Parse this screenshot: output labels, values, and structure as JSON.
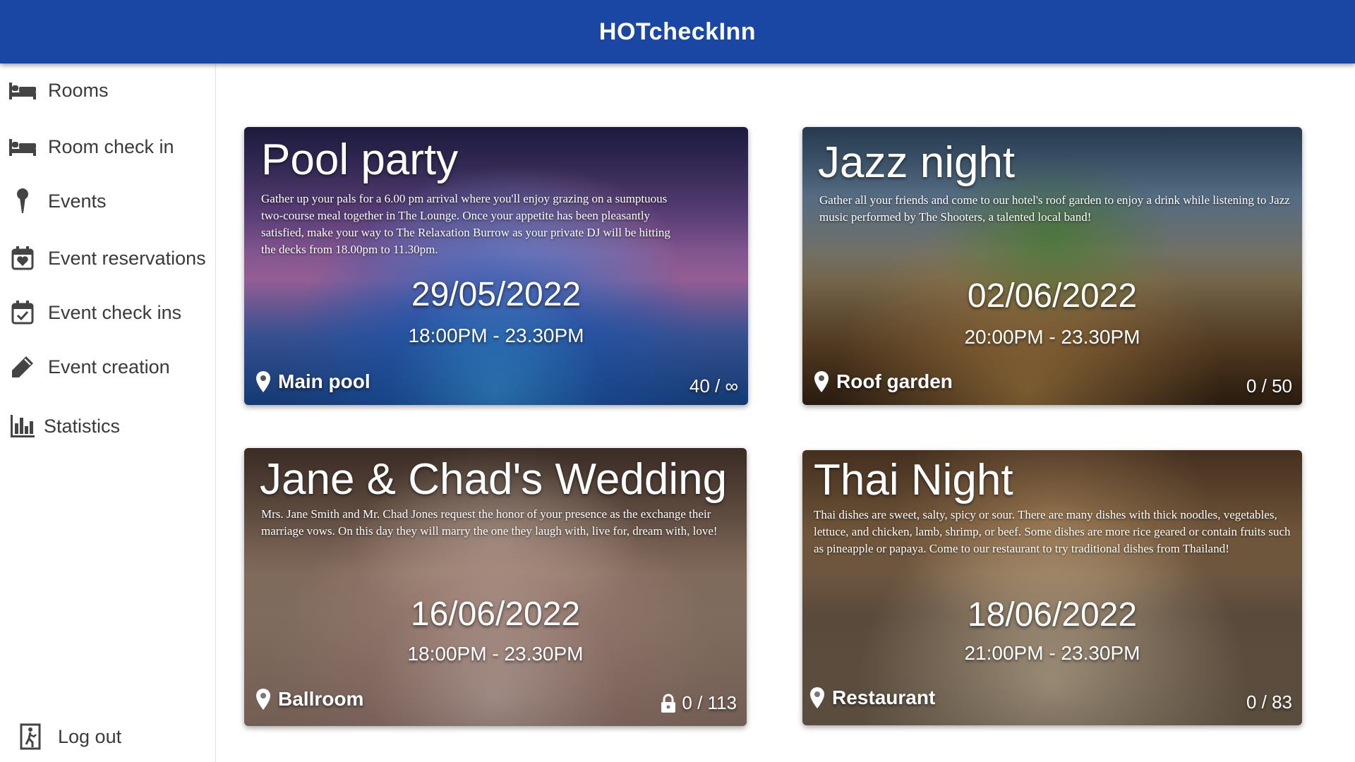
{
  "app": {
    "title": "HOTcheckInn"
  },
  "sidebar": {
    "items": [
      {
        "label": "Rooms",
        "icon": "bed-icon"
      },
      {
        "label": "Room check in",
        "icon": "bed-icon"
      },
      {
        "label": "Events",
        "icon": "pin-icon"
      },
      {
        "label": "Event reservations",
        "icon": "calendar-heart-icon"
      },
      {
        "label": "Event check ins",
        "icon": "calendar-check-icon"
      },
      {
        "label": "Event creation",
        "icon": "pen-icon"
      },
      {
        "label": "Statistics",
        "icon": "bar-chart-icon"
      }
    ],
    "logout": {
      "label": "Log out",
      "icon": "exit-icon"
    }
  },
  "events": [
    {
      "title": "Pool party",
      "description": "Gather up your pals for a 6.00 pm arrival where you'll enjoy grazing on a sumptuous two-course meal together in The Lounge. Once your appetite has been pleasantly satisfied, make your way to The Relaxation Burrow as your private DJ will be hitting the decks from 18.00pm to 11.30pm.",
      "date": "29/05/2022",
      "time": "18:00PM - 23.30PM",
      "location": "Main pool",
      "capacity": "40 / ∞",
      "locked": false
    },
    {
      "title": "Jazz night",
      "description": "Gather all your friends and come to our hotel's roof garden to enjoy a drink while listening to Jazz music performed by The Shooters, a talented local band!",
      "date": "02/06/2022",
      "time": "20:00PM - 23.30PM",
      "location": "Roof garden",
      "capacity": "0 / 50",
      "locked": false
    },
    {
      "title": "Jane & Chad's Wedding",
      "description": "Mrs. Jane Smith and Mr. Chad Jones request the honor of your presence as the exchange their marriage vows. On this day they will marry the one they laugh with, live for, dream with, love!",
      "date": "16/06/2022",
      "time": "18:00PM - 23.30PM",
      "location": "Ballroom",
      "capacity": "0 / 113",
      "locked": true
    },
    {
      "title": "Thai Night",
      "description": "Thai dishes are sweet, salty, spicy or sour. There are many dishes with thick noodles, vegetables, lettuce, and chicken, lamb, shrimp, or beef. Some dishes are more rice geared or contain fruits such as pineapple or papaya. Come to our restaurant to try traditional dishes from Thailand!",
      "date": "18/06/2022",
      "time": "21:00PM - 23.30PM",
      "location": "Restaurant",
      "capacity": "0 / 83",
      "locked": false
    }
  ],
  "colors": {
    "header": "#1a47a3",
    "text": "#3a3a3a"
  }
}
